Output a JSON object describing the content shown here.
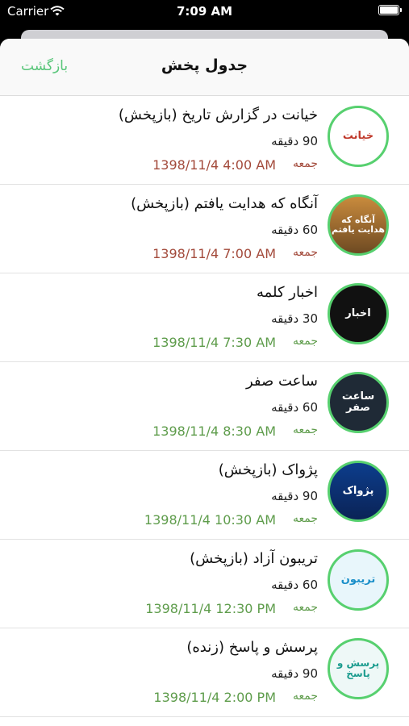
{
  "status_bar": {
    "carrier": "Carrier",
    "time": "7:09 AM"
  },
  "nav": {
    "title": "جدول پخش",
    "back_label": "بازگشت"
  },
  "colors": {
    "accent": "#59c67a",
    "past_time": "#a34a3b",
    "upcoming_time": "#5e9c4b",
    "ring": "#57d06f"
  },
  "programs": [
    {
      "thumb_text": "خيانت",
      "title": "خیانت در گزارش تاریخ (بازپخش)",
      "duration": "90 دقیقه",
      "day": "جمعه",
      "datetime": "1398/11/4 4:00   AM",
      "status": "past"
    },
    {
      "thumb_text": "آنگاه که هدایت یافتم",
      "title": "آنگاه که هدایت یافتم (بازپخش)",
      "duration": "60 دقیقه",
      "day": "جمعه",
      "datetime": "1398/11/4 7:00   AM",
      "status": "past"
    },
    {
      "thumb_text": "اخبار",
      "title": "اخبار کلمه",
      "duration": "30 دقیقه",
      "day": "جمعه",
      "datetime": "1398/11/4 7:30   AM",
      "status": "upcoming"
    },
    {
      "thumb_text": "ساعت صفر",
      "title": "ساعت صفر",
      "duration": "60 دقیقه",
      "day": "جمعه",
      "datetime": "1398/11/4 8:30   AM",
      "status": "upcoming"
    },
    {
      "thumb_text": "پژواک",
      "title": "پژواک (بازپخش)",
      "duration": "90 دقیقه",
      "day": "جمعه",
      "datetime": "1398/11/4 10:30   AM",
      "status": "upcoming"
    },
    {
      "thumb_text": "تریبون",
      "title": "تریبون آزاد (بازپخش)",
      "duration": "60 دقیقه",
      "day": "جمعه",
      "datetime": "1398/11/4 12:30   PM",
      "status": "upcoming"
    },
    {
      "thumb_text": "پرسش و پاسخ",
      "title": "پرسش و پاسخ (زنده)",
      "duration": "90 دقیقه",
      "day": "جمعه",
      "datetime": "1398/11/4 2:00   PM",
      "status": "upcoming"
    }
  ]
}
